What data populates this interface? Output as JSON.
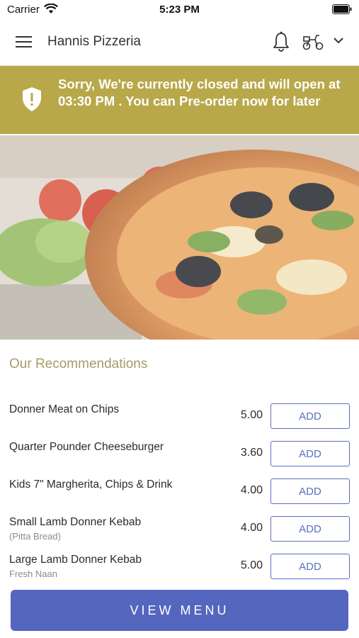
{
  "status_bar": {
    "carrier": "Carrier",
    "time": "5:23 PM"
  },
  "header": {
    "title": "Hannis Pizzeria"
  },
  "banner": {
    "message": "Sorry, We're currently closed and will open at 03:30 PM . You can Pre-order now for later",
    "color": "#b8a84a"
  },
  "recommendations": {
    "title": "Our Recommendations",
    "items": [
      {
        "name": "Donner Meat on Chips",
        "sub": "",
        "price": "5.00",
        "button": "ADD"
      },
      {
        "name": "Quarter Pounder Cheeseburger",
        "sub": "",
        "price": "3.60",
        "button": "ADD"
      },
      {
        "name": "Kids 7\" Margherita, Chips & Drink",
        "sub": "",
        "price": "4.00",
        "button": "ADD"
      },
      {
        "name": "Small Lamb Donner Kebab",
        "sub": "(Pitta Bread)",
        "price": "4.00",
        "button": "ADD"
      },
      {
        "name": "Large Lamb Donner Kebab",
        "sub": "Fresh Naan",
        "price": "5.00",
        "button": "ADD"
      }
    ]
  },
  "footer": {
    "view_menu": "VIEW MENU",
    "accent": "#5566be"
  }
}
